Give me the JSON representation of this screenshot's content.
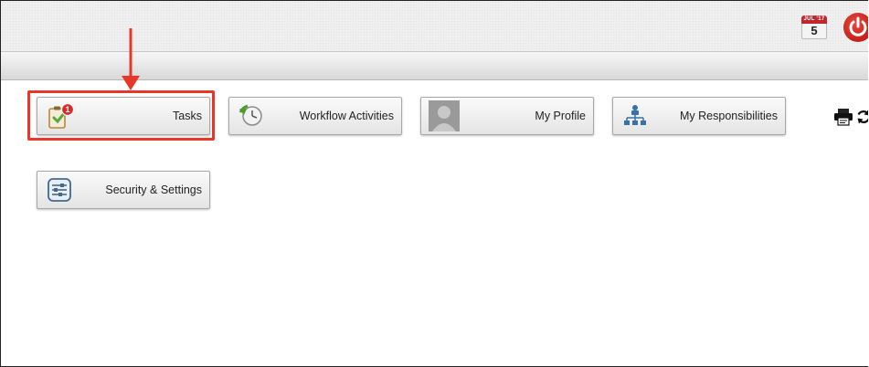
{
  "header": {
    "calendar": {
      "month": "JUL",
      "year": "'17",
      "day": "5",
      "icon": "calendar-icon"
    },
    "power_icon": "power-icon"
  },
  "toolbar": {
    "icons": [
      "printer-icon",
      "refresh-icon"
    ]
  },
  "tiles": [
    {
      "label": "Tasks",
      "icon": "tasks-clipboard-icon",
      "badge": "1"
    },
    {
      "label": "Workflow Activities",
      "icon": "workflow-clock-icon"
    },
    {
      "label": "My Profile",
      "icon": "profile-avatar-icon"
    },
    {
      "label": "My Responsibilities",
      "icon": "org-chart-icon"
    },
    {
      "label": "Security & Settings",
      "icon": "settings-sliders-icon"
    }
  ],
  "annotation": {
    "highlight_color": "#e8372a",
    "target": "Tasks"
  },
  "colors": {
    "accent_red": "#c0282e",
    "tile_border": "#a8a8a8"
  }
}
